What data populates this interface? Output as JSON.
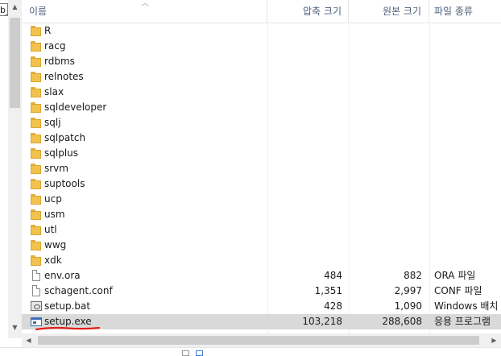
{
  "tree_pane": {
    "partial_label": "b_"
  },
  "columns": {
    "name": "이름",
    "compressed_size": "압축 크기",
    "original_size": "원본 크기",
    "file_type": "파일 종류"
  },
  "rows": [
    {
      "name": "R",
      "icon": "folder-icon",
      "compressed": "",
      "original": "",
      "type": ""
    },
    {
      "name": "racg",
      "icon": "folder-icon",
      "compressed": "",
      "original": "",
      "type": ""
    },
    {
      "name": "rdbms",
      "icon": "folder-icon",
      "compressed": "",
      "original": "",
      "type": ""
    },
    {
      "name": "relnotes",
      "icon": "folder-icon",
      "compressed": "",
      "original": "",
      "type": ""
    },
    {
      "name": "slax",
      "icon": "folder-icon",
      "compressed": "",
      "original": "",
      "type": ""
    },
    {
      "name": "sqldeveloper",
      "icon": "folder-icon",
      "compressed": "",
      "original": "",
      "type": ""
    },
    {
      "name": "sqlj",
      "icon": "folder-icon",
      "compressed": "",
      "original": "",
      "type": ""
    },
    {
      "name": "sqlpatch",
      "icon": "folder-icon",
      "compressed": "",
      "original": "",
      "type": ""
    },
    {
      "name": "sqlplus",
      "icon": "folder-icon",
      "compressed": "",
      "original": "",
      "type": ""
    },
    {
      "name": "srvm",
      "icon": "folder-icon",
      "compressed": "",
      "original": "",
      "type": ""
    },
    {
      "name": "suptools",
      "icon": "folder-icon",
      "compressed": "",
      "original": "",
      "type": ""
    },
    {
      "name": "ucp",
      "icon": "folder-icon",
      "compressed": "",
      "original": "",
      "type": ""
    },
    {
      "name": "usm",
      "icon": "folder-icon",
      "compressed": "",
      "original": "",
      "type": ""
    },
    {
      "name": "utl",
      "icon": "folder-icon",
      "compressed": "",
      "original": "",
      "type": ""
    },
    {
      "name": "wwg",
      "icon": "folder-icon",
      "compressed": "",
      "original": "",
      "type": ""
    },
    {
      "name": "xdk",
      "icon": "folder-icon",
      "compressed": "",
      "original": "",
      "type": ""
    },
    {
      "name": "env.ora",
      "icon": "file-icon",
      "compressed": "484",
      "original": "882",
      "type": "ORA 파일"
    },
    {
      "name": "schagent.conf",
      "icon": "file-icon",
      "compressed": "1,351",
      "original": "2,997",
      "type": "CONF 파일"
    },
    {
      "name": "setup.bat",
      "icon": "batch-file-icon",
      "compressed": "428",
      "original": "1,090",
      "type": "Windows 배치"
    },
    {
      "name": "setup.exe",
      "icon": "application-icon",
      "compressed": "103,218",
      "original": "288,608",
      "type": "응용 프로그램",
      "selected": true
    }
  ],
  "colors": {
    "selection": "#d9d9d9",
    "underline_annotation": "#e0201c",
    "header_text": "#4c607a"
  }
}
